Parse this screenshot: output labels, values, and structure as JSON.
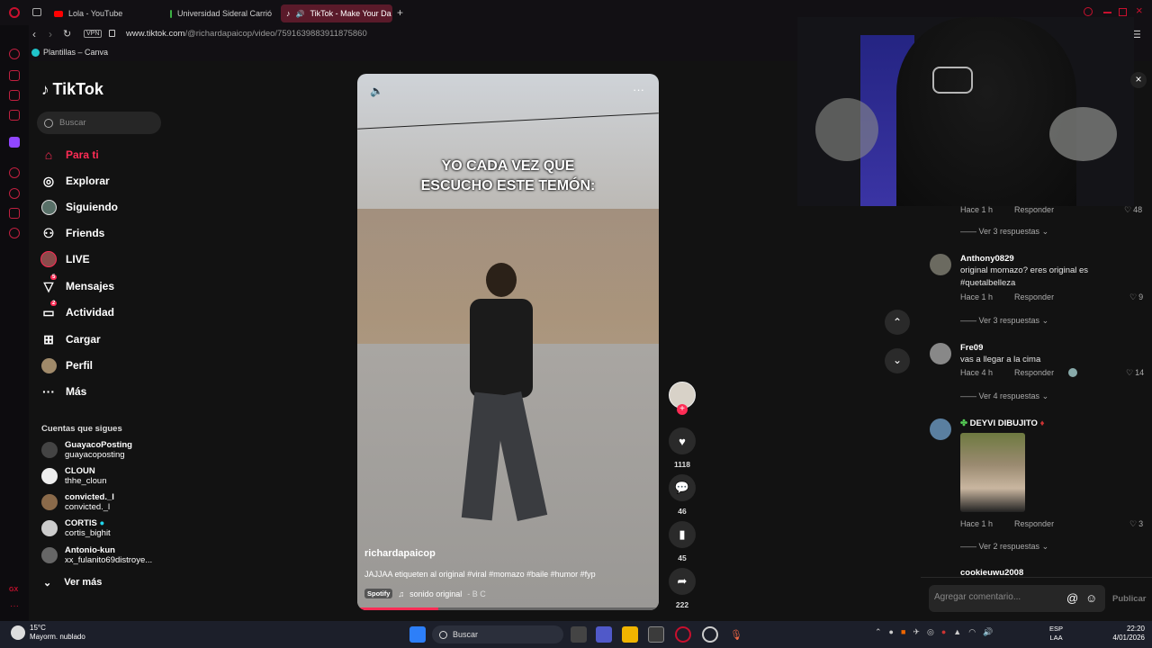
{
  "browser": {
    "tabs": [
      {
        "label": "Lola - YouTube"
      },
      {
        "label": "Universidad Sideral Carrió"
      },
      {
        "label": "TikTok - Make Your Da"
      }
    ],
    "url_domain": "www.tiktok.com",
    "url_path": "/@richardapaicop/video/7591639883911875860",
    "vpn_label": "VPN",
    "bookmark": "Plantillas – Canva"
  },
  "tiktok": {
    "logo": "TikTok",
    "search_placeholder": "Buscar",
    "nav": [
      {
        "label": "Para ti",
        "icon": "home-icon"
      },
      {
        "label": "Explorar",
        "icon": "compass-icon"
      },
      {
        "label": "Siguiendo",
        "icon": "following-avatar-icon"
      },
      {
        "label": "Friends",
        "icon": "friends-icon"
      },
      {
        "label": "LIVE",
        "icon": "live-icon"
      },
      {
        "label": "Mensajes",
        "icon": "messages-icon",
        "badge": "5"
      },
      {
        "label": "Actividad",
        "icon": "activity-icon",
        "badge": "2"
      },
      {
        "label": "Cargar",
        "icon": "upload-icon"
      },
      {
        "label": "Perfil",
        "icon": "profile-icon"
      },
      {
        "label": "Más",
        "icon": "more-icon"
      }
    ],
    "following_title": "Cuentas que sigues",
    "following": [
      {
        "name": "GuayacoPosting",
        "handle": "guayacoposting"
      },
      {
        "name": "CLOUN",
        "handle": "thhe_cloun"
      },
      {
        "name": "convicted._l",
        "handle": "convicted._l"
      },
      {
        "name": "CORTIS",
        "handle": "cortis_bighit"
      },
      {
        "name": "Antonio-kun",
        "handle": "xx_fulanito69distroye..."
      }
    ],
    "see_more": "Ver más"
  },
  "video": {
    "caption_overlay_line1": "YO CADA VEZ QUE",
    "caption_overlay_line2": "ESCUCHO ESTE TEMÓN:",
    "author": "richardapaicop",
    "description": "JAJJAA etiqueten al original  #viral #momazo #baile #humor #fyp",
    "music_badge": "Spotify",
    "music": "sonido original",
    "music_author": "- B C",
    "progress": 0.27
  },
  "actions": {
    "likes": "1118",
    "comments": "46",
    "saves": "45",
    "shares": "222"
  },
  "comments": {
    "items": [
      {
        "meta_time": "Hace 1 h",
        "reply": "Responder",
        "likes": "48",
        "replies": "Ver 3 respuestas"
      },
      {
        "name": "Anthony0829",
        "text1": "original momazo? eres original es",
        "text2": "#quetalbelleza",
        "meta_time": "Hace 1 h",
        "reply": "Responder",
        "likes": "9",
        "replies": "Ver 3 respuestas"
      },
      {
        "name": "Fre09",
        "text1": "vas a llegar a la cima",
        "meta_time": "Hace 4 h",
        "reply": "Responder",
        "likes": "14",
        "replies": "Ver 4 respuestas"
      },
      {
        "name": "DEYVI DIBUJITO",
        "meta_time": "Hace 1 h",
        "reply": "Responder",
        "likes": "3",
        "replies": "Ver 2 respuestas"
      },
      {
        "name": "cookieuwu2008"
      }
    ],
    "input_placeholder": "Agregar comentario...",
    "publish": "Publicar"
  },
  "taskbar": {
    "weather_temp": "15°C",
    "weather_desc": "Mayorm. nublado",
    "search": "Buscar",
    "lang1": "ESP",
    "lang2": "LAA",
    "time": "22:20",
    "date": "4/01/2026"
  },
  "colors": {
    "accent": "#fe2c55",
    "opera": "#c8102e"
  }
}
